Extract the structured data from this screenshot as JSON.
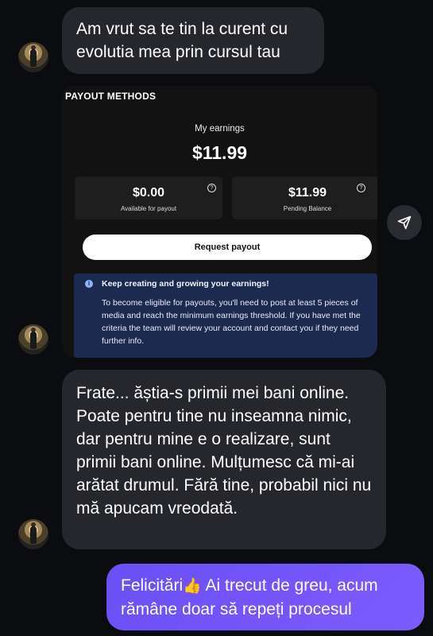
{
  "messages": {
    "incoming_1": "Am vrut sa te tin la curent cu evolutia mea prin cursul tau",
    "incoming_2": "Frate... ăștia-s primii mei bani online. Poate pentru tine nu inseamna nimic, dar pentru mine e o realizare, sunt primii bani online. Mulțumesc că mi-ai arătat drumul. Fără tine, probabil nici nu mă apucam vreodată.",
    "outgoing_1_before": "Felicitări",
    "outgoing_1_emoji": "👍",
    "outgoing_1_after": " Ai trecut de greu, acum rămâne doar să repeți procesul"
  },
  "shared_image": {
    "title": "PAYOUT METHODS",
    "earnings_label": "My earnings",
    "earnings_value": "$11.99",
    "available_value": "$0.00",
    "available_label": "Available for payout",
    "pending_value": "$11.99",
    "pending_label": "Pending Balance",
    "help_glyph": "?",
    "request_button": "Request payout",
    "info_icon": "i",
    "info_title": "Keep creating and growing your earnings!",
    "info_body": "To become eligible for payouts, you'll need to post at least 5 pieces of media and reach the minimum earnings threshold. If you have met the criteria the team will review your account and contact you if they need further info."
  },
  "icons": {
    "share": "paper-plane-icon",
    "avatar": "user-avatar"
  },
  "colors": {
    "background": "#0b0c10",
    "incoming_bubble": "#26272c",
    "outgoing_bubble": "#7b5cff",
    "info_banner": "#1b2a4e"
  }
}
